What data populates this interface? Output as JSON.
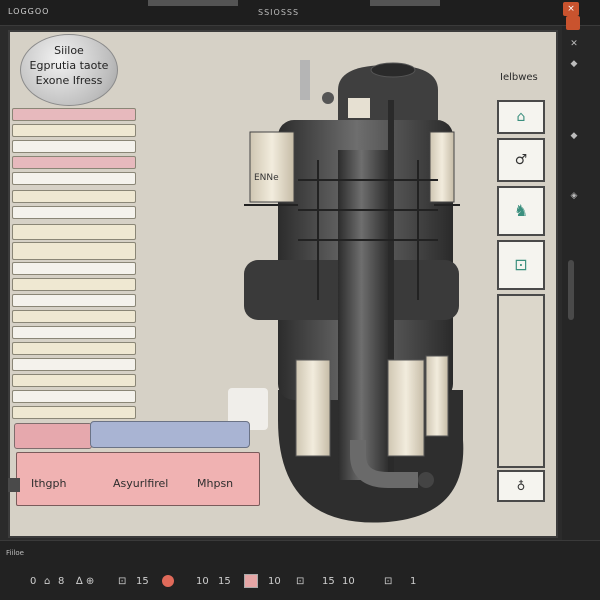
{
  "window": {
    "app_name": "LOGGOO",
    "title": "SSIOSSS",
    "close_glyph": "×",
    "colors": {
      "frame": "#1e1e1e",
      "canvas": "#d6d1c6",
      "accent": "#c9532e"
    }
  },
  "badge": {
    "line1": "Siiloe",
    "line2": "Egprutia taote",
    "line3": "Exone Ifress"
  },
  "side_panel": {
    "label": "Ielbwes",
    "buttons": [
      {
        "glyph": "⌂",
        "icon": "home-icon"
      },
      {
        "glyph": "♂",
        "icon": "link-icon"
      },
      {
        "glyph": "♞",
        "icon": "figure-icon"
      },
      {
        "glyph": "⊡",
        "icon": "grid-icon"
      },
      {
        "glyph": "",
        "icon": "panel-area"
      },
      {
        "glyph": "♁",
        "icon": "settings-icon"
      }
    ]
  },
  "machine": {
    "tank_label": "ENNe"
  },
  "footer": {
    "label1": "Ithgph",
    "label2": "Asyurlfirel",
    "label3": "Mhpsn"
  },
  "status": {
    "label": "Fiiloe",
    "items": [
      "0",
      "⌂",
      "8",
      "∆ ⊕",
      "⊡",
      "15",
      "10",
      "15",
      "10",
      "⊡",
      "15",
      "10",
      "⊡",
      "1"
    ]
  }
}
